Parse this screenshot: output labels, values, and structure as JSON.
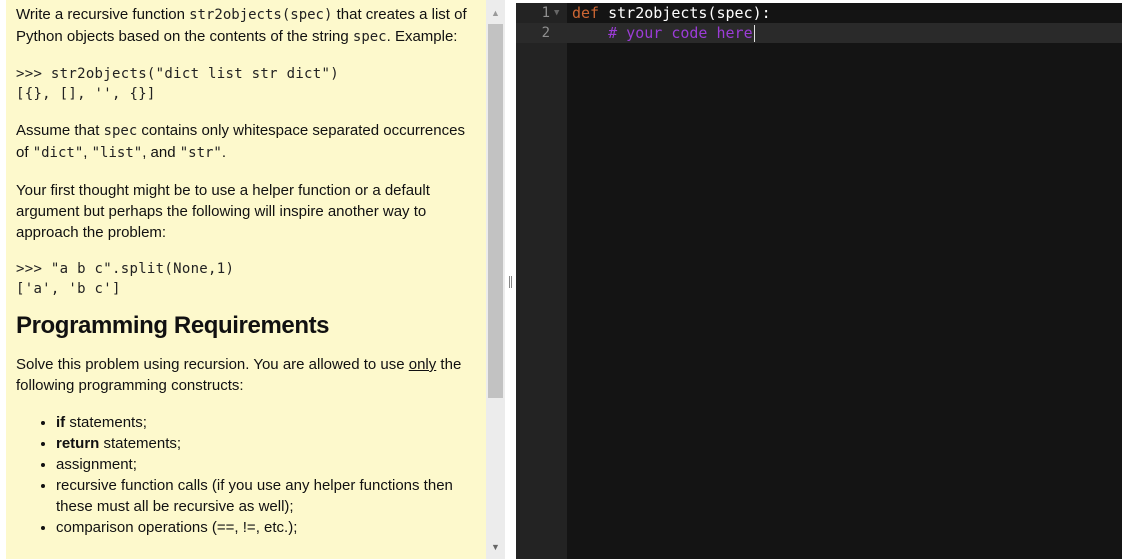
{
  "problem": {
    "intro_pre": "Write a recursive function ",
    "func_name": "str2objects(spec)",
    "intro_mid": " that creates a list of Python objects based on the contents of the string ",
    "spec_word": "spec",
    "intro_end": ". Example:",
    "example1_line1": ">>> str2objects(\"dict list str dict\")",
    "example1_line2": "[{}, [], '', {}]",
    "assume_pre": "Assume that ",
    "assume_spec": "spec",
    "assume_mid": " contains only whitespace separated occurrences of ",
    "q_dict": "\"dict\"",
    "comma1": ", ",
    "q_list": "\"list\"",
    "and_text": ", and ",
    "q_str": "\"str\"",
    "period": ".",
    "hint_text": "Your first thought might be to use a helper function or a default argument but perhaps the following will inspire another way to approach the problem:",
    "example2_line1": ">>> \"a b c\".split(None,1)",
    "example2_line2": "['a', 'b c']",
    "requirements_heading": "Programming Requirements",
    "req_pre": "Solve this problem using recursion. You are allowed to use ",
    "req_only": "only",
    "req_post": " the following programming constructs:",
    "bullets": [
      {
        "bold": "if",
        "text": " statements;"
      },
      {
        "bold": "return",
        "text": " statements;"
      },
      {
        "bold": "",
        "text": "assignment;"
      },
      {
        "bold": "",
        "text": "recursive function calls (if you use any helper functions then these must all be recursive as well);"
      },
      {
        "bold": "",
        "text": "comparison operations (==, !=, etc.);"
      }
    ]
  },
  "editor": {
    "lines": [
      {
        "num": "1",
        "kw": "def",
        "rest": " str2objects(spec):"
      },
      {
        "num": "2",
        "comment": "    # your code here"
      }
    ]
  },
  "scrollbar": {
    "up": "▲",
    "down": "▼"
  },
  "colors": {
    "panel_bg": "#fdf9cc",
    "editor_bg": "#141414",
    "keyword": "#cc6633",
    "comment": "#9b3cd6"
  }
}
